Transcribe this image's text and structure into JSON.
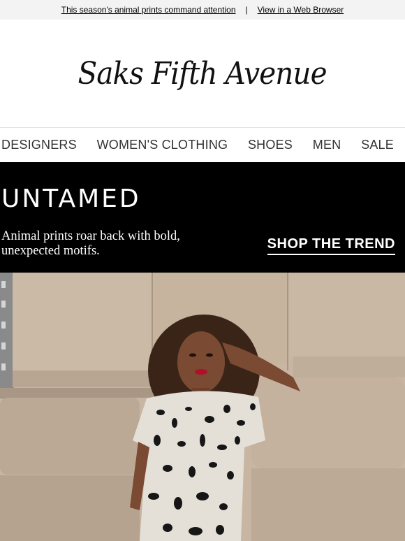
{
  "preheader": {
    "message": "This season's animal prints command attention",
    "separator": "|",
    "browser_link": "View in a Web Browser"
  },
  "brand": {
    "logo_text": "Saks Fifth Avenue"
  },
  "nav": {
    "items": [
      {
        "label": "DESIGNERS"
      },
      {
        "label": "WOMEN'S CLOTHING"
      },
      {
        "label": "SHOES"
      },
      {
        "label": "MEN"
      },
      {
        "label": "SALE"
      }
    ]
  },
  "hero": {
    "headline": "UNTAMED",
    "subline": "Animal prints roar back with bold, unexpected motifs.",
    "cta": "SHOP THE TREND"
  },
  "photo": {
    "subject": "model-in-animal-print-dress",
    "colors": {
      "stone": "#c8b6a2",
      "stone_dark": "#a89684",
      "dress": "#e4e0d8",
      "spots": "#161616",
      "skin": "#7a4a32",
      "hair": "#3a2418",
      "lips": "#b0102a"
    }
  }
}
